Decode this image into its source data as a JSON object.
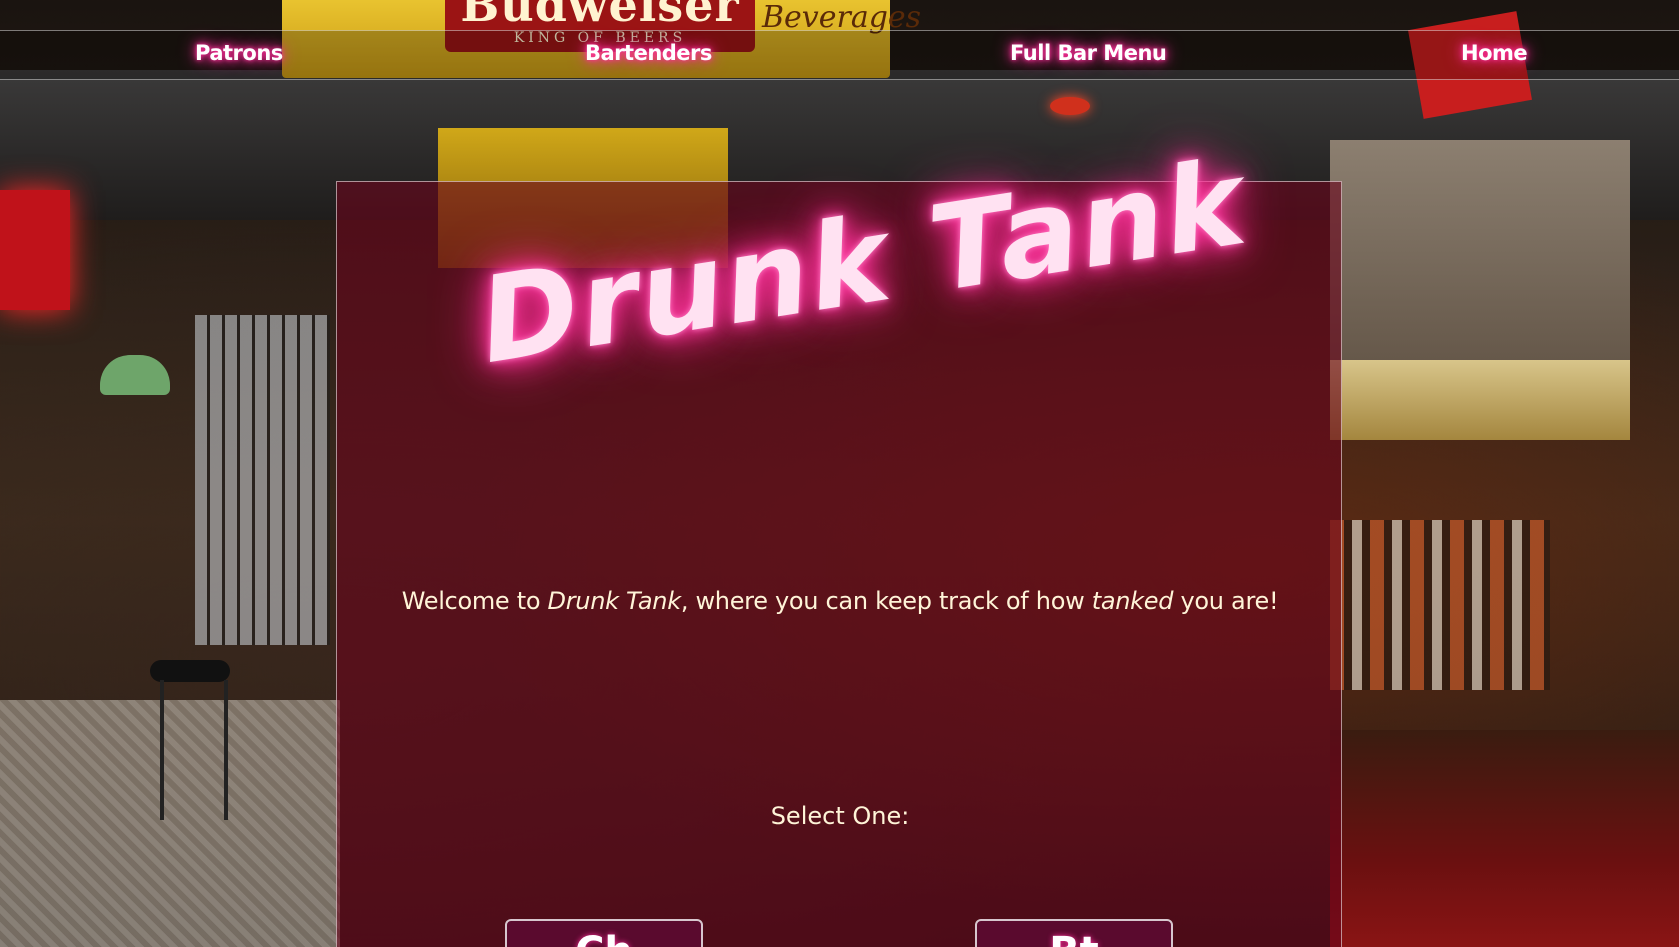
{
  "nav": {
    "patrons": "Patrons",
    "bartenders": "Bartenders",
    "full_menu": "Full Bar Menu",
    "home": "Home"
  },
  "background": {
    "sign_brand": "Budweiser",
    "sign_sub": "KING OF BEERS",
    "sign_side": "Beverages"
  },
  "hero": {
    "logo": "Drunk Tank"
  },
  "welcome": {
    "prefix": "Welcome to ",
    "brand": "Drunk Tank",
    "middle": ", where you can keep track of how ",
    "emph": "tanked",
    "suffix": " you are!"
  },
  "select": {
    "label": "Select One:",
    "option_a": "Ch",
    "option_b": "Bt"
  },
  "colors": {
    "neon_pink": "#ff2f9a",
    "panel": "#69051c",
    "text_cream": "#fff4d8"
  }
}
